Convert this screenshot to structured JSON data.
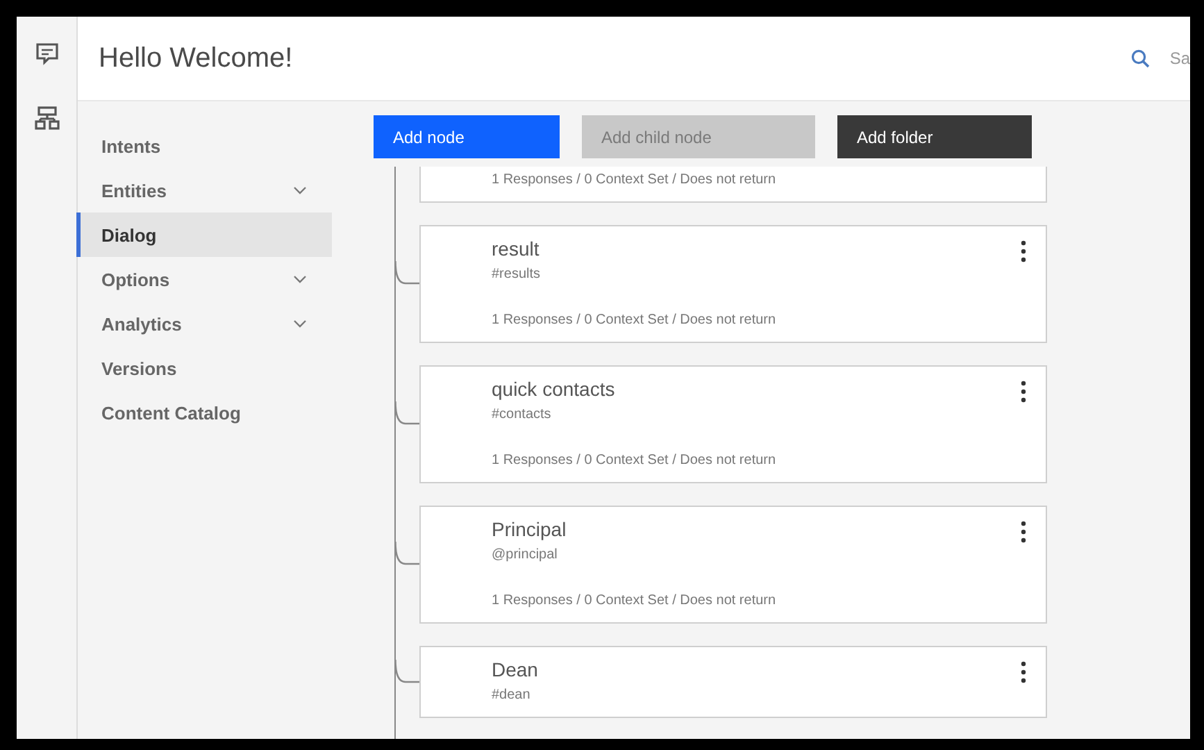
{
  "header": {
    "title": "Hello Welcome!",
    "search_label": "Sa"
  },
  "sidebar": {
    "items": [
      {
        "label": "Intents",
        "expandable": false,
        "selected": false
      },
      {
        "label": "Entities",
        "expandable": true,
        "selected": false
      },
      {
        "label": "Dialog",
        "expandable": false,
        "selected": true
      },
      {
        "label": "Options",
        "expandable": true,
        "selected": false
      },
      {
        "label": "Analytics",
        "expandable": true,
        "selected": false
      },
      {
        "label": "Versions",
        "expandable": false,
        "selected": false
      },
      {
        "label": "Content Catalog",
        "expandable": false,
        "selected": false
      }
    ]
  },
  "toolbar": [
    {
      "label": "Add node",
      "kind": "primary",
      "disabled": false
    },
    {
      "label": "Add child node",
      "kind": "secondary",
      "disabled": true
    },
    {
      "label": "Add folder",
      "kind": "dark",
      "disabled": false
    }
  ],
  "nodes": [
    {
      "summary": "1 Responses / 0 Context Set / Does not return"
    },
    {
      "title": "result",
      "condition": "#results",
      "summary": "1 Responses / 0 Context Set / Does not return"
    },
    {
      "title": "quick contacts",
      "condition": "#contacts",
      "summary": "1 Responses / 0 Context Set / Does not return"
    },
    {
      "title": "Principal",
      "condition": "@principal",
      "summary": "1 Responses / 0 Context Set / Does not return"
    },
    {
      "title": "Dean",
      "condition": "#dean"
    }
  ]
}
